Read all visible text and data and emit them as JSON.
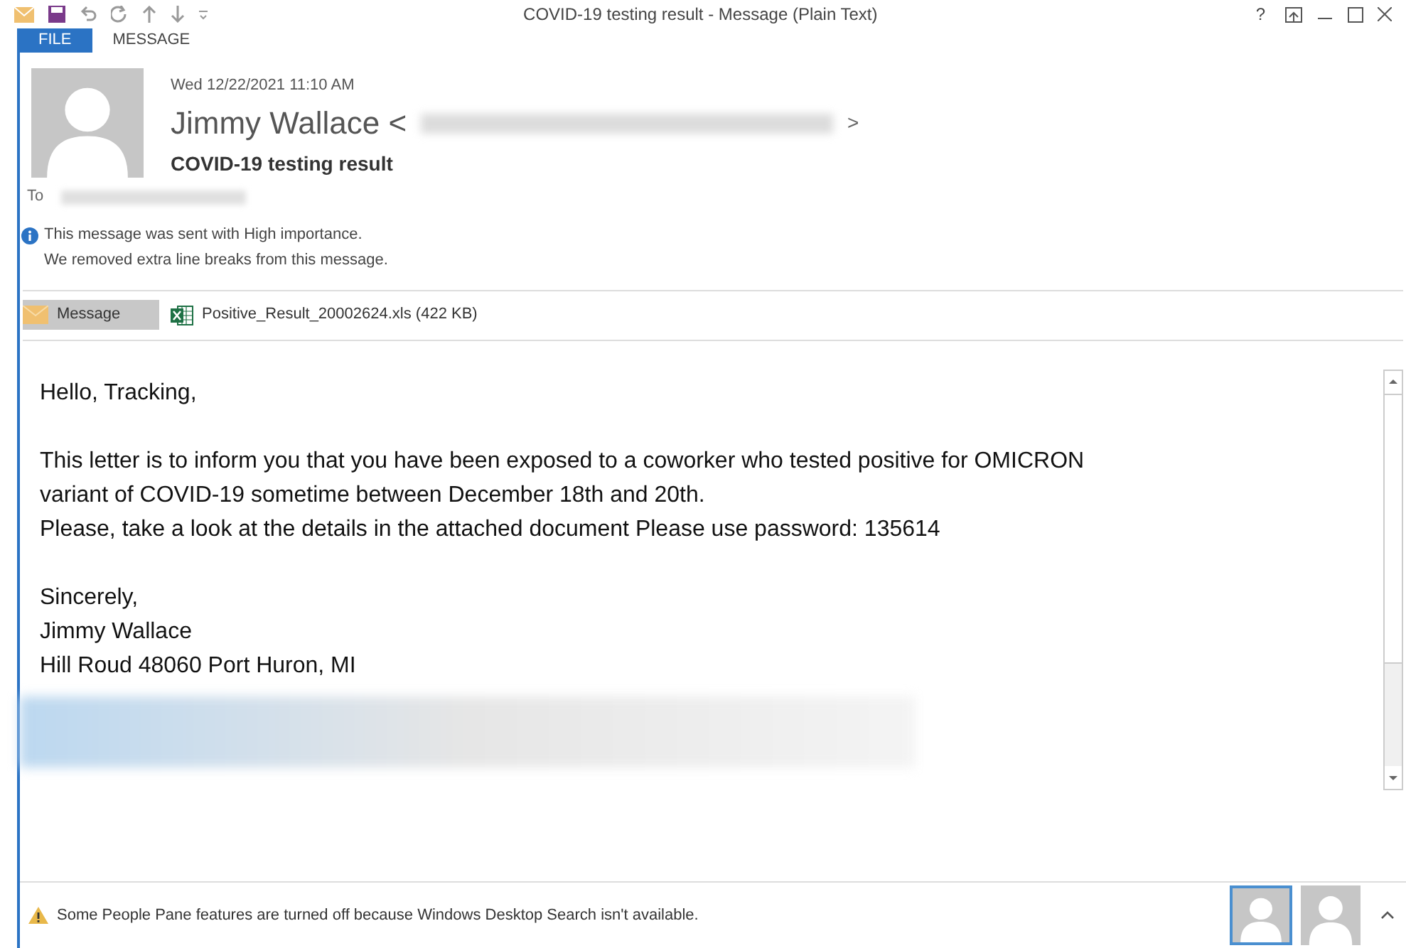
{
  "window": {
    "title": "COVID-19 testing result - Message (Plain Text)",
    "help": "?"
  },
  "tabs": [
    {
      "label": "FILE",
      "selected": true
    },
    {
      "label": "MESSAGE",
      "selected": false
    }
  ],
  "header": {
    "date": "Wed 12/22/2021 11:10 AM",
    "sender": "Jimmy Wallace <",
    "sender_end": ">",
    "subject": "COVID-19 testing result",
    "to_label": "To",
    "notices": [
      {
        "kind": "info",
        "text": "This message was sent with High importance."
      },
      {
        "kind": "plain",
        "text": "We removed extra line breaks from this message."
      }
    ]
  },
  "attachments": [
    {
      "kind": "message",
      "label": "Message",
      "selected": true
    },
    {
      "kind": "excel",
      "label": "Positive_Result_20002624.xls (422 KB)",
      "selected": false
    }
  ],
  "body": [
    [
      "Hello, Tracking,"
    ],
    [
      "This letter is to inform you that you have been exposed to a coworker who tested positive for OMICRON",
      "variant of COVID-19 sometime between December 18th and 20th.",
      "Please, take a look at the details in the attached document Please use password: 135614"
    ],
    [
      "Sincerely,",
      "Jimmy Wallace",
      "Hill Roud 48060 Port Huron, MI"
    ]
  ],
  "status_bar": {
    "text": "Some People Pane features are turned off because Windows Desktop Search isn't available."
  }
}
